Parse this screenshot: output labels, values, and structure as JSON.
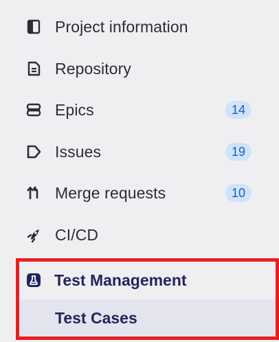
{
  "sidebar": {
    "items": [
      {
        "label": "Project information",
        "icon": "project-info-icon"
      },
      {
        "label": "Repository",
        "icon": "repository-icon"
      },
      {
        "label": "Epics",
        "icon": "epics-icon",
        "count": "14"
      },
      {
        "label": "Issues",
        "icon": "issues-icon",
        "count": "19"
      },
      {
        "label": "Merge requests",
        "icon": "merge-requests-icon",
        "count": "10"
      },
      {
        "label": "CI/CD",
        "icon": "ci-cd-icon"
      }
    ],
    "active_section": {
      "label": "Test Management",
      "icon": "test-management-icon",
      "subitem": {
        "label": "Test Cases"
      }
    }
  },
  "colors": {
    "sidebar_bg": "#efeff2",
    "text": "#2c2c34",
    "active_text": "#24245e",
    "badge_bg": "#cfe3fb",
    "badge_text": "#1f5fb8",
    "highlight_border": "#e81f1f"
  }
}
